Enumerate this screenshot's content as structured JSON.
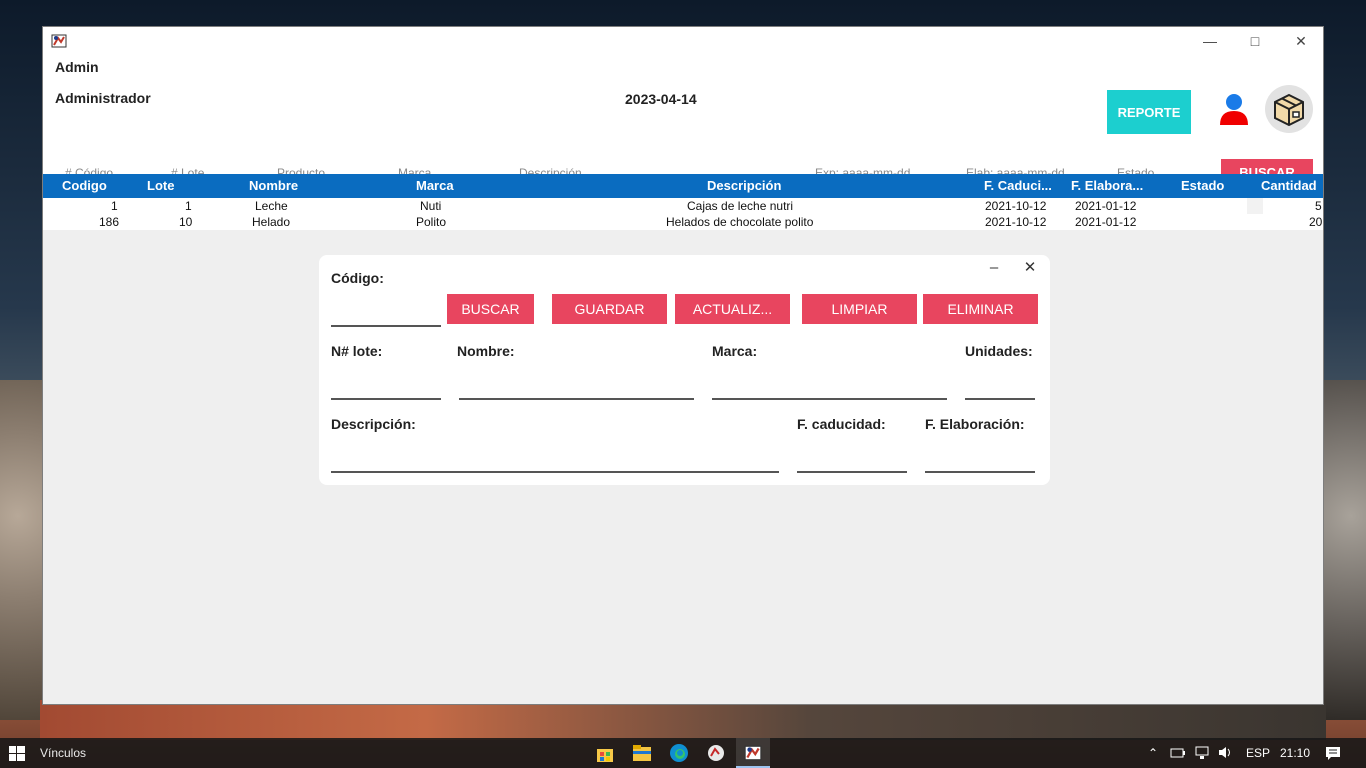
{
  "window": {
    "user": "Admin",
    "role": "Administrador",
    "date": "2023-04-14",
    "reporte_label": "REPORTE",
    "search_label": "BUSCAR"
  },
  "filters": {
    "codigo": "# Código",
    "lote": "# Lote",
    "producto": "Producto",
    "marca": "Marca",
    "descripcion": "Descripción",
    "expiracion": "Exp: aaaa-mm-dd",
    "elaboracion": "Elab: aaaa-mm-dd",
    "estado": "Estado"
  },
  "table": {
    "headers": [
      "Codigo",
      "Lote",
      "Nombre",
      "Marca",
      "Descripción",
      "F. Caduci...",
      "F. Elabora...",
      "Estado",
      "Cantidad"
    ],
    "rows": [
      [
        "1",
        "1",
        "Leche",
        "Nuti",
        "Cajas de leche  nutri",
        "2021-10-12",
        "2021-01-12",
        "",
        "5"
      ],
      [
        "186",
        "10",
        "Helado",
        "Polito",
        "Helados de chocolate polito",
        "2021-10-12",
        "2021-01-12",
        "",
        "20"
      ]
    ]
  },
  "dialog": {
    "codigo_label": "Código:",
    "buttons": [
      "BUSCAR",
      "GUARDAR",
      "ACTUALIZ...",
      "LIMPIAR",
      "ELIMINAR"
    ],
    "lote_label": "N# lote:",
    "nombre_label": "Nombre:",
    "marca_label": "Marca:",
    "unidades_label": "Unidades:",
    "descripcion_label": "Descripción:",
    "caducidad_label": "F. caducidad:",
    "elaboracion_label": "F. Elaboración:"
  },
  "taskbar": {
    "toolbar": "Vínculos",
    "language": "ESP",
    "time": "21:10"
  },
  "colors": {
    "accent_button": "#e8455f",
    "report_button": "#1ccfcf",
    "table_header": "#0a6cc0"
  }
}
